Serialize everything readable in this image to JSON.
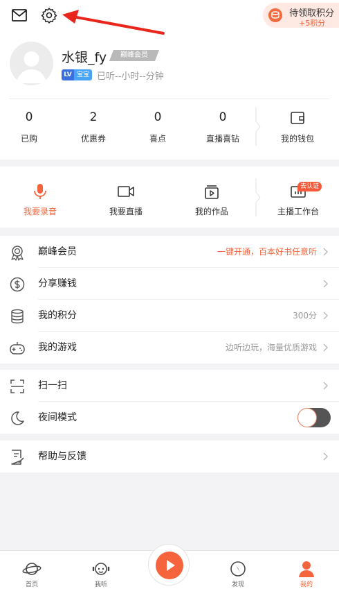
{
  "topbar": {
    "points_line1": "待领取积分",
    "points_line2": "+5积分"
  },
  "profile": {
    "username": "水银_fy",
    "vip_tag": "巅峰会员",
    "lv_label": "LV",
    "lv_name": "宝宝",
    "listen_time": "已听--小时--分钟"
  },
  "stats": [
    {
      "value": "0",
      "label": "已购"
    },
    {
      "value": "2",
      "label": "优惠券"
    },
    {
      "value": "0",
      "label": "喜点"
    },
    {
      "value": "0",
      "label": "直播喜钻"
    }
  ],
  "wallet_label": "我的钱包",
  "actions": [
    {
      "label": "我要录音",
      "icon": "microphone-icon"
    },
    {
      "label": "我要直播",
      "icon": "video-camera-icon"
    },
    {
      "label": "我的作品",
      "icon": "works-icon"
    },
    {
      "label": "主播工作台",
      "icon": "dashboard-icon",
      "badge": "去认证"
    }
  ],
  "menu1": [
    {
      "label": "巅峰会员",
      "right": "一键开通，百本好书任意听",
      "icon": "vip-badge-icon"
    },
    {
      "label": "分享赚钱",
      "right": "",
      "icon": "dollar-icon"
    },
    {
      "label": "我的积分",
      "right": "300分",
      "icon": "coins-stack-icon"
    },
    {
      "label": "我的游戏",
      "right": "边听边玩，海量优质游戏",
      "icon": "gamepad-icon"
    }
  ],
  "menu2": [
    {
      "label": "扫一扫",
      "icon": "scan-icon"
    },
    {
      "label": "夜间模式",
      "icon": "moon-icon",
      "toggle_on": true
    }
  ],
  "menu3": [
    {
      "label": "帮助与反馈",
      "icon": "help-doc-icon"
    }
  ],
  "bottomnav": [
    {
      "label": "首页",
      "icon": "planet-icon"
    },
    {
      "label": "我听",
      "icon": "headphones-icon"
    },
    {
      "label": "发现",
      "icon": "compass-icon"
    },
    {
      "label": "我的",
      "icon": "person-icon",
      "active": true
    }
  ],
  "colors": {
    "accent": "#f5643c",
    "lv_blue": "#3a6fe0",
    "toggle_track": "#555555"
  }
}
